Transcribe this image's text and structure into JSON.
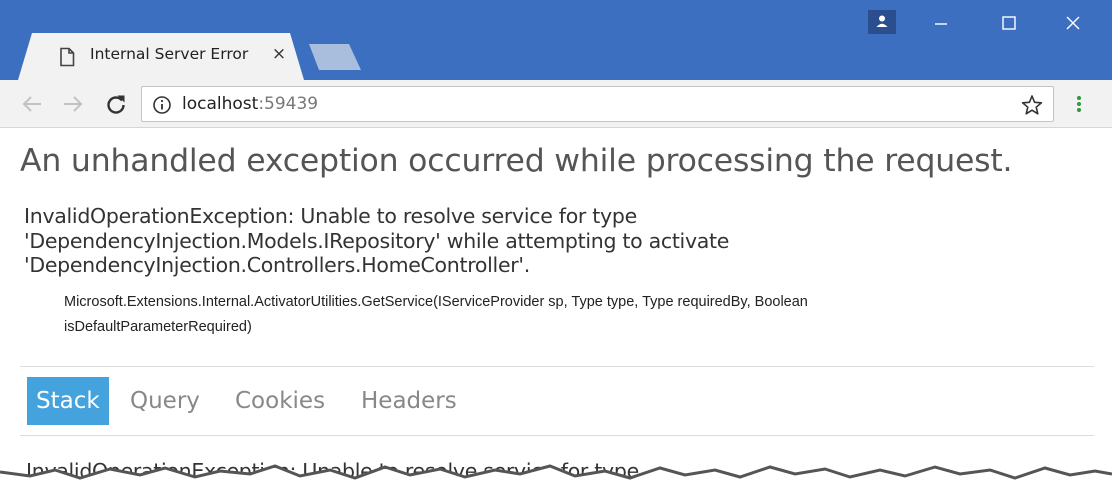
{
  "browser": {
    "tab": {
      "title": "Internal Server Error",
      "close_glyph": "×",
      "icon": "page-icon"
    },
    "window_controls": [
      "profile-icon",
      "minimize-icon",
      "maximize-icon",
      "close-icon"
    ],
    "toolbar": {
      "url_host": "localhost",
      "url_port": ":59439",
      "icons": [
        "back-arrow-icon",
        "forward-arrow-icon",
        "reload-icon",
        "info-icon",
        "star-icon",
        "menu-icon"
      ]
    },
    "colors": {
      "titlebar": "#3c6fc0",
      "tab": "#f2f2f2",
      "active_tab": "#44a3dc"
    }
  },
  "page": {
    "title": "An unhandled exception occurred while processing the request.",
    "message_lines": [
      "InvalidOperationException: Unable to resolve service for type",
      "'DependencyInjection.Models.IRepository' while attempting to activate",
      "'DependencyInjection.Controllers.HomeController'."
    ],
    "location_lines": [
      "Microsoft.Extensions.Internal.ActivatorUtilities.GetService(IServiceProvider sp, Type type, Type requiredBy, Boolean",
      "isDefaultParameterRequired)"
    ],
    "tabs": [
      {
        "label": "Stack",
        "active": true
      },
      {
        "label": "Query",
        "active": false
      },
      {
        "label": "Cookies",
        "active": false
      },
      {
        "label": "Headers",
        "active": false
      }
    ],
    "stack_text": "InvalidOperationException: Unable to resolve service for type"
  }
}
